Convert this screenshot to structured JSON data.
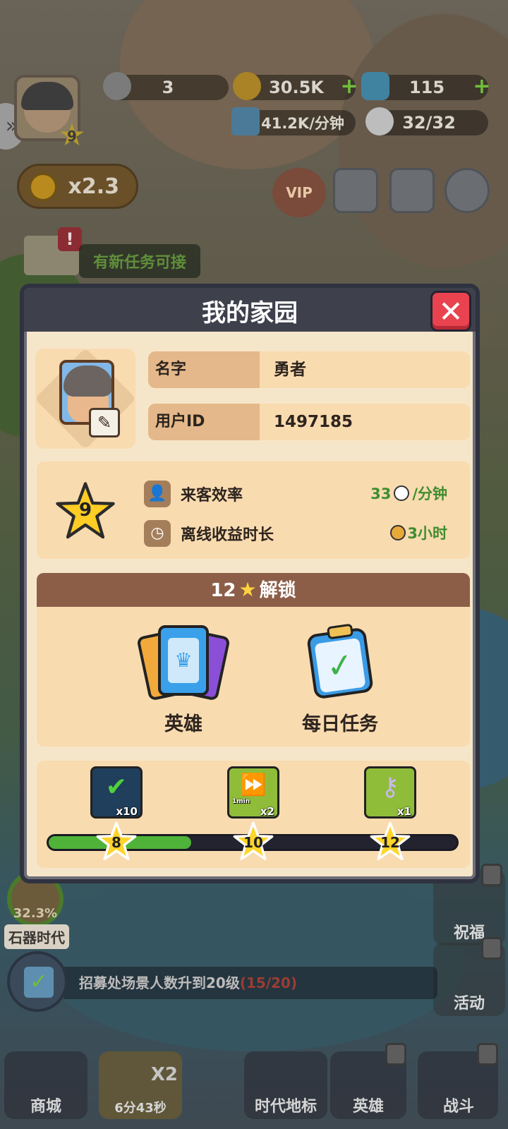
{
  "hud": {
    "player_level": "9",
    "resources": {
      "stone": "3",
      "coins": "30.5K",
      "gems": "115",
      "income_rate": "41.2K/分钟",
      "visitors": "32/32"
    },
    "multiplier": "x2.3",
    "vip_label": "VIP",
    "quest_hint": "有新任务可接",
    "quest_badge": "!"
  },
  "dialog": {
    "title": "我的家园",
    "close_glyph": "✕",
    "profile": {
      "name_label": "名字",
      "name_value": "勇者",
      "id_label": "用户ID",
      "id_value": "1497185"
    },
    "level": {
      "value": "9",
      "visit_label": "来客效率",
      "visit_value": "33",
      "visit_unit": "/分钟",
      "offline_label": "离线收益时长",
      "offline_value": "3小时"
    },
    "unlock": {
      "required": "12",
      "star": "★",
      "label": "解锁",
      "items": [
        {
          "label": "英雄"
        },
        {
          "label": "每日任务"
        }
      ]
    },
    "rewards": {
      "items": [
        {
          "qty": "x10"
        },
        {
          "qty": "x2",
          "sub": "1min"
        },
        {
          "qty": "x1"
        }
      ],
      "milestones": [
        "8",
        "10",
        "12"
      ],
      "progress": 0.35
    }
  },
  "era": {
    "percent": "32.3%",
    "name": "石器时代"
  },
  "task": {
    "text": "招募处场景人数升到20级",
    "progress": "(15/20)"
  },
  "side": {
    "bless": "祝福",
    "event": "活动"
  },
  "nav": {
    "shop": "商城",
    "boost_multiplier": "X2",
    "boost_timer": "6分43秒",
    "landmark": "时代地标",
    "heroes": "英雄",
    "battle": "战斗"
  },
  "colors": {
    "dialog_bg": "#f6e6c9",
    "card_bg": "#f9dbb0",
    "header_brown": "#8c5e48",
    "close_red": "#e8434f",
    "green_value": "#3f8d2f",
    "progress_green": "#4fb33a"
  }
}
